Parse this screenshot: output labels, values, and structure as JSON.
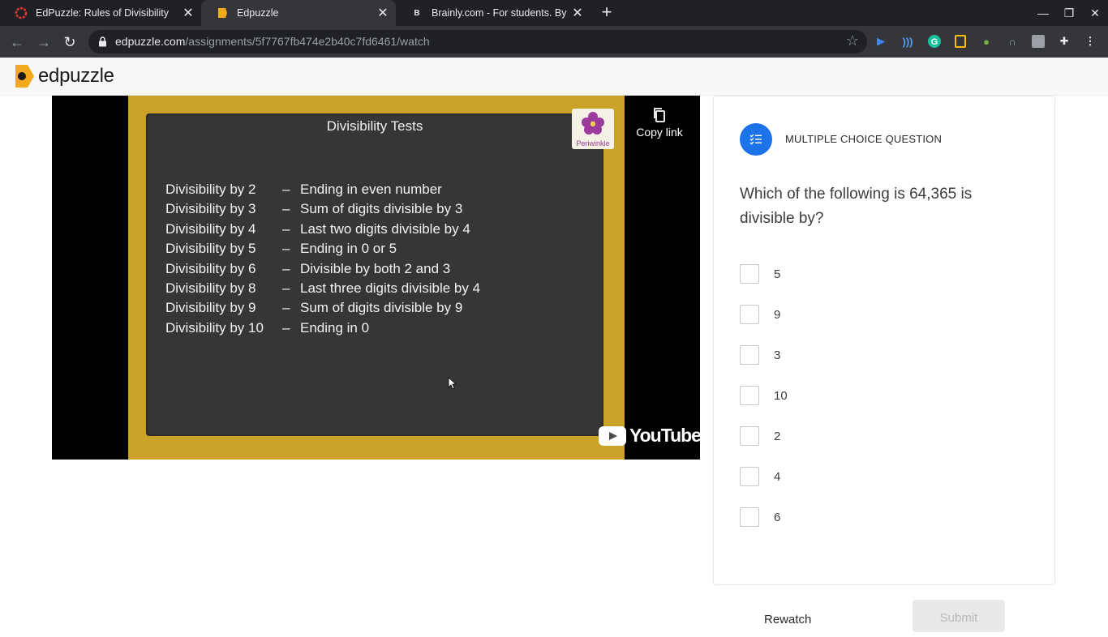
{
  "browser": {
    "tabs": [
      {
        "title": "EdPuzzle: Rules of Divisibility",
        "icon": "red-ring-icon"
      },
      {
        "title": "Edpuzzle",
        "icon": "edpuzzle-icon"
      },
      {
        "title": "Brainly.com - For students. By students",
        "icon": "brainly-icon"
      }
    ],
    "active_tab_index": 1,
    "url_host": "edpuzzle.com",
    "url_path": "/assignments/5f7767fb474e2b40c7fd6461/watch"
  },
  "app": {
    "logo_text": "edpuzzle"
  },
  "video": {
    "board_title": "Divisibility Tests",
    "rules": [
      {
        "test": "Divisibility by 2",
        "rule": "Ending in even number"
      },
      {
        "test": "Divisibility by 3",
        "rule": "Sum of digits divisible by 3"
      },
      {
        "test": "Divisibility by 4",
        "rule": "Last two digits divisible by 4"
      },
      {
        "test": "Divisibility by 5",
        "rule": "Ending in 0 or 5"
      },
      {
        "test": "Divisibility by 6",
        "rule": "Divisible by both 2 and 3"
      },
      {
        "test": "Divisibility by 8",
        "rule": "Last three digits divisible by 4"
      },
      {
        "test": "Divisibility by 9",
        "rule": "Sum of digits divisible by 9"
      },
      {
        "test": "Divisibility by 10",
        "rule": "Ending in 0"
      }
    ],
    "dash": "–",
    "channel_logo_text": "Periwinkle",
    "copy_link_label": "Copy link",
    "youtube_label": "YouTube"
  },
  "question": {
    "type_label": "MULTIPLE CHOICE QUESTION",
    "text": "Which of the following is 64,365 is divisible by?",
    "options": [
      "5",
      "9",
      "3",
      "10",
      "2",
      "4",
      "6"
    ]
  },
  "actions": {
    "rewatch_label": "Rewatch",
    "submit_label": "Submit"
  },
  "colors": {
    "accent": "#1a73e8",
    "board_frame": "#c9a227",
    "board": "#363636"
  }
}
